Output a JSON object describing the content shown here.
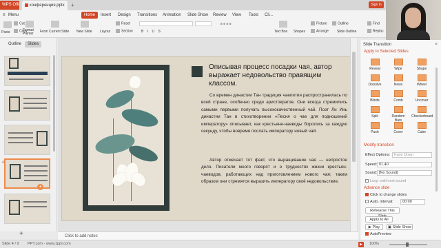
{
  "titlebar": {
    "app_tab": "WPS Office",
    "doc_tab": "конференция.pptx",
    "sign_in": "Sign in"
  },
  "menu": {
    "items": [
      {
        "label": "Menu"
      },
      {
        "label": "Home"
      },
      {
        "label": "Insert"
      },
      {
        "label": "Design"
      },
      {
        "label": "Transitions"
      },
      {
        "label": "Animation"
      },
      {
        "label": "Slide Show"
      },
      {
        "label": "Review"
      },
      {
        "label": "View"
      },
      {
        "label": "Tools"
      },
      {
        "label": "Cli..."
      }
    ],
    "active": "Home"
  },
  "ribbon": {
    "cut": "Cut",
    "copy": "Copy",
    "paste": "Paste",
    "format_painter": "Format\nPainter",
    "from_current_slide": "From Current Slide",
    "new_slide": "New Slide",
    "layout": "Layout",
    "reset": "Reset",
    "section": "Section",
    "picture": "Picture",
    "text_box": "Text Box",
    "shapes": "Shapes",
    "arrange": "Arrange",
    "outline": "Outline",
    "slide_outline": "Slide Outline",
    "find": "Find",
    "replace": "Replac"
  },
  "left_panel": {
    "tab_outline": "Outline",
    "tab_slides": "Slides",
    "selected_slide_number": "4"
  },
  "slide": {
    "title": "Описывая процесс посадки чая, автор выражает недовольство правящим классом.",
    "paragraph1": "Со времен династии Тан традиция чаепития распространилась по всей стране, особенно среди аристократов. Они всегда стремились самыми первыми получать высококачественный чай. Поэт Ли Инь династии Тан в стихотворении «Песня о чае для подношений императору» описывает, как крестьяне-чаеводы боролись за каждую секунду, чтобы вовремя послать императору новый чай.",
    "paragraph2": "Автор отмечает тот факт, что выращивание чая — непростое дело. Писатели много говорят и о трудностях жизни крестьян-чаеводов, работающих над приготовлением нового чая; таким образом они стремятся выразить императору своё недовольствие."
  },
  "notes": {
    "placeholder": "Click to add notes"
  },
  "task_pane": {
    "title": "Slide Transition",
    "apply_section": "Apply to Selected Slides",
    "effects": [
      {
        "label": "Reveal"
      },
      {
        "label": "Wipe"
      },
      {
        "label": "Shape"
      },
      {
        "label": "Dissolve"
      },
      {
        "label": "News"
      },
      {
        "label": "Wheel"
      },
      {
        "label": "Blinds"
      },
      {
        "label": "Comb"
      },
      {
        "label": "Uncover"
      },
      {
        "label": "Split"
      },
      {
        "label": "Random Bars"
      },
      {
        "label": "Checkerboard"
      },
      {
        "label": "Push"
      },
      {
        "label": "Cover"
      },
      {
        "label": "Cube"
      }
    ],
    "modify_section": "Modify transition",
    "effect_options_label": "Effect Options:",
    "effect_options_value": "Fade Down",
    "speed_label": "Speed:",
    "speed_value": "01.40",
    "sound_label": "Sound:",
    "sound_value": "[No Sound]",
    "loop_label": "Loop until next sound",
    "advance_section": "Advance slide",
    "on_click_label": "Click to change slides",
    "auto_label": "Auto. interval:",
    "auto_value": "00:00",
    "rehearse_label": "Rehearse This Slide",
    "apply_all_label": "Apply to All",
    "play_label": "Play",
    "slideshow_label": "Slide Show",
    "autopreview_label": "AutoPreview"
  },
  "status": {
    "slide_counter": "Slide 4 / 9",
    "theme": "PPT.com - www.1ppt.com",
    "zoom": "100%"
  }
}
